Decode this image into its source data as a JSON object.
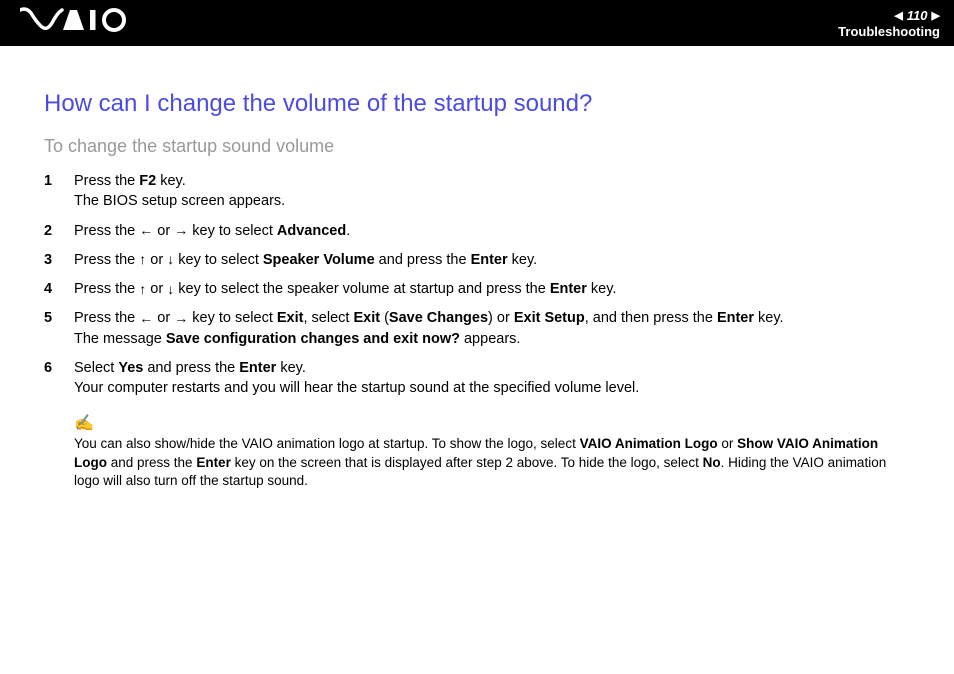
{
  "header": {
    "logo_text": "VAIO",
    "page_number": "110",
    "section": "Troubleshooting"
  },
  "main": {
    "heading": "How can I change the volume of the startup sound?",
    "subheading": "To change the startup sound volume",
    "steps": [
      {
        "n": "1",
        "pre": "Press the ",
        "b1": "F2",
        "post": " key.",
        "line2": "The BIOS setup screen appears."
      },
      {
        "n": "2",
        "pre": "Press the ",
        "icon1": "←",
        "mid1": " or ",
        "icon2": "→",
        "post1": " key to select ",
        "b1": "Advanced",
        "post2": "."
      },
      {
        "n": "3",
        "pre": "Press the ",
        "icon1": "↑",
        "mid1": " or ",
        "icon2": "↓",
        "post1": " key to select ",
        "b1": "Speaker Volume",
        "mid2": " and press the ",
        "b2": "Enter",
        "post2": " key."
      },
      {
        "n": "4",
        "pre": "Press the ",
        "icon1": "↑",
        "mid1": " or ",
        "icon2": "↓",
        "post1": " key to select the speaker volume at startup and press the ",
        "b1": "Enter",
        "post2": " key."
      },
      {
        "n": "5",
        "pre": "Press the ",
        "icon1": "←",
        "mid1": " or ",
        "icon2": "→",
        "post1": " key to select ",
        "b1": "Exit",
        "mid2": ", select ",
        "b2": "Exit",
        "mid3": " (",
        "b3": "Save Changes",
        "mid4": ") or ",
        "b4": "Exit Setup",
        "mid5": ", and then press the ",
        "b5": "Enter",
        "post2": " key.",
        "line2a": "The message ",
        "line2b": "Save configuration changes and exit now?",
        "line2c": " appears."
      },
      {
        "n": "6",
        "pre": "Select ",
        "b1": "Yes",
        "mid1": " and press the ",
        "b2": "Enter",
        "post1": " key.",
        "line2": "Your computer restarts and you will hear the startup sound at the specified volume level."
      }
    ],
    "note": {
      "t1": "You can also show/hide the VAIO animation logo at startup. To show the logo, select ",
      "b1": "VAIO Animation Logo",
      "t2": " or ",
      "b2": "Show VAIO Animation Logo",
      "t3": " and press the ",
      "b3": "Enter",
      "t4": " key on the screen that is displayed after step 2 above. To hide the logo, select ",
      "b4": "No",
      "t5": ". Hiding the VAIO animation logo will also turn off the startup sound."
    }
  }
}
